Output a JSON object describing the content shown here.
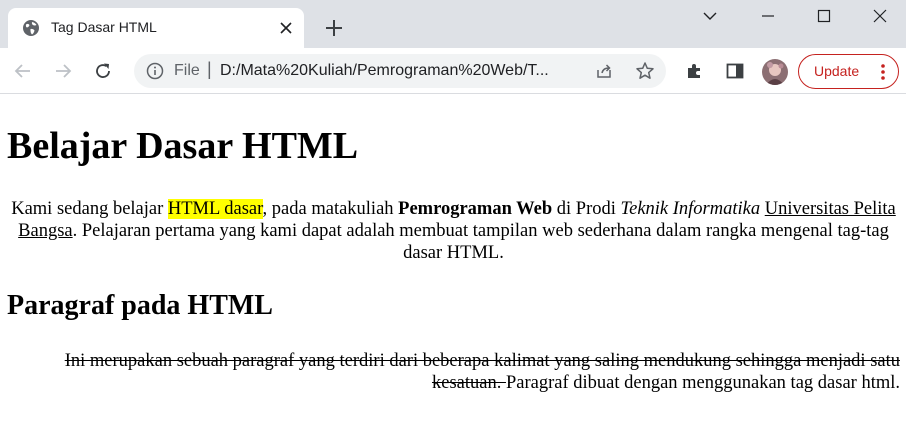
{
  "browser": {
    "tab": {
      "title": "Tag Dasar HTML"
    },
    "address": {
      "scheme": "File",
      "separator": "|",
      "url": "D:/Mata%20Kuliah/Pemrograman%20Web/T..."
    },
    "update_label": "Update",
    "icons": {
      "tab": "globe-icon",
      "new_tab": "plus-icon",
      "back": "arrow-left-icon",
      "forward": "arrow-right-icon",
      "reload": "reload-icon",
      "site_info": "info-icon",
      "share": "share-icon",
      "bookmark": "star-icon",
      "extensions": "puzzle-icon",
      "side_panel": "side-panel-icon",
      "menu": "three-dots-icon"
    },
    "colors": {
      "tabstrip": "#dee1e6",
      "update_accent": "#c5221f",
      "omnibox": "#f1f3f4"
    }
  },
  "content": {
    "heading1": "Belajar Dasar HTML",
    "p1": {
      "t1": "Kami sedang belajar ",
      "highlight": "HTML dasar",
      "t2": ", pada matakuliah ",
      "bold": "Pemrograman Web",
      "t3": " di Prodi ",
      "italic": "Teknik Informatika",
      "t4": " ",
      "underline": "Universitas Pelita Bangsa",
      "t5": ". Pelajaran pertama yang kami dapat adalah membuat tampilan web sederhana dalam rangka mengenal tag-tag dasar HTML."
    },
    "heading2": "Paragraf pada HTML",
    "p2": {
      "strike": "Ini merupakan sebuah paragraf yang terdiri dari beberapa kalimat yang saling mendukung sehingga menjadi satu kesatuan. ",
      "t1": "Paragraf dibuat dengan menggunakan tag dasar html."
    },
    "colors": {
      "highlight": "#ffff00"
    }
  }
}
